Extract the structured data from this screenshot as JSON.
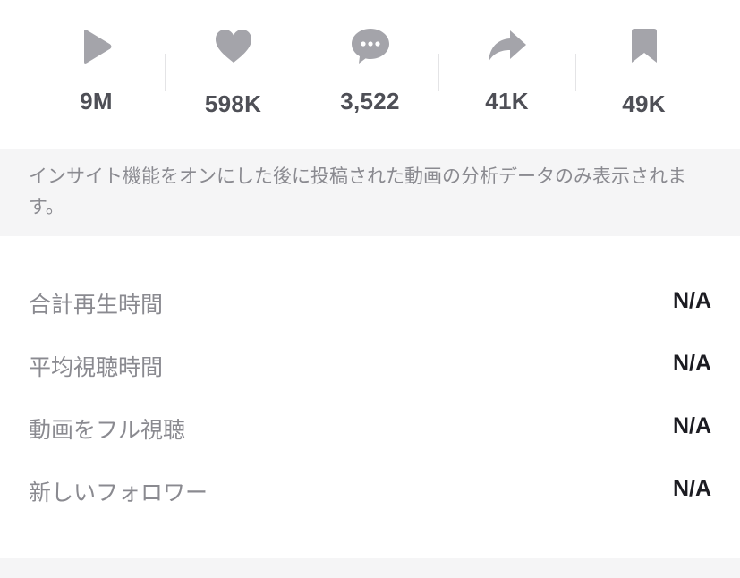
{
  "colors": {
    "icon": "#a4a4aa",
    "stat_value": "#4e4f56",
    "notice_bg": "#f5f5f6",
    "label": "#8a8a90",
    "metric_value": "#1c1c22"
  },
  "stats": [
    {
      "icon": "play-icon",
      "value": "9M"
    },
    {
      "icon": "heart-icon",
      "value": "598K"
    },
    {
      "icon": "comment-icon",
      "value": "3,522"
    },
    {
      "icon": "share-icon",
      "value": "41K"
    },
    {
      "icon": "bookmark-icon",
      "value": "49K"
    }
  ],
  "notice": {
    "text": "インサイト機能をオンにした後に投稿された動画の分析データのみ表示されます。"
  },
  "metrics": [
    {
      "label": "合計再生時間",
      "value": "N/A"
    },
    {
      "label": "平均視聴時間",
      "value": "N/A"
    },
    {
      "label": "動画をフル視聴",
      "value": "N/A"
    },
    {
      "label": "新しいフォロワー",
      "value": "N/A"
    }
  ]
}
